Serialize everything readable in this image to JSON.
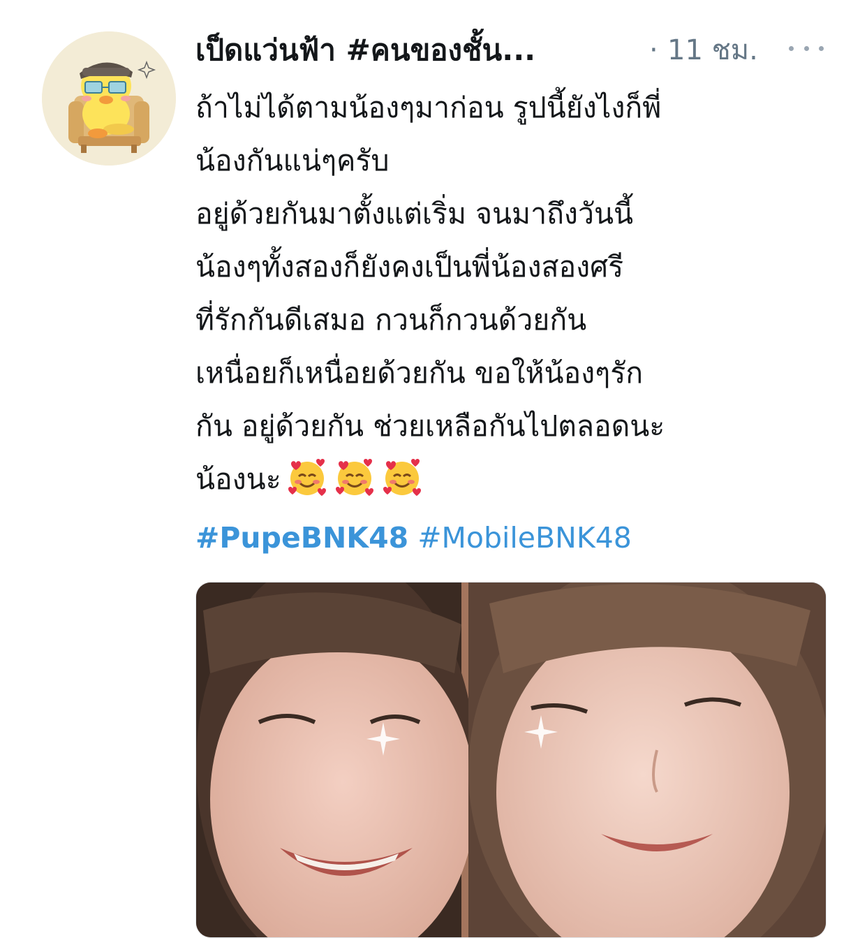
{
  "tweet": {
    "display_name": "เป็ดแว่นฟ้า #คนของชั้น...",
    "dot": "·",
    "time": "11 ชม.",
    "more_icon": "more-horizontal-icon",
    "avatar_icon": "duck-character-avatar",
    "text_lines": [
      "ถ้าไม่ได้ตามน้องๆมาก่อน รูปนี้ยังไงก็พี่",
      "น้องกันแน่ๆครับ",
      "อยู่ด้วยกันมาตั้งแต่เริ่ม จนมาถึงวันนี้",
      "น้องๆทั้งสองก็ยังคงเป็นพี่น้องสองศรี",
      "ที่รักกันดีเสมอ กวนก็กวนด้วยกัน",
      "เหนื่อยก็เหนื่อยด้วยกัน ขอให้น้องๆรัก",
      "กัน อยู่ด้วยกัน ช่วยเหลือกันไปตลอดนะ",
      "น้องนะ"
    ],
    "emoji_count_label": "smiling-face-with-hearts",
    "hashtags": [
      "#PupeBNK48",
      "#MobileBNK48"
    ],
    "media_alt": "photo",
    "colors": {
      "text": "#14171a",
      "secondary": "#657786",
      "link": "#3b94d9"
    }
  }
}
